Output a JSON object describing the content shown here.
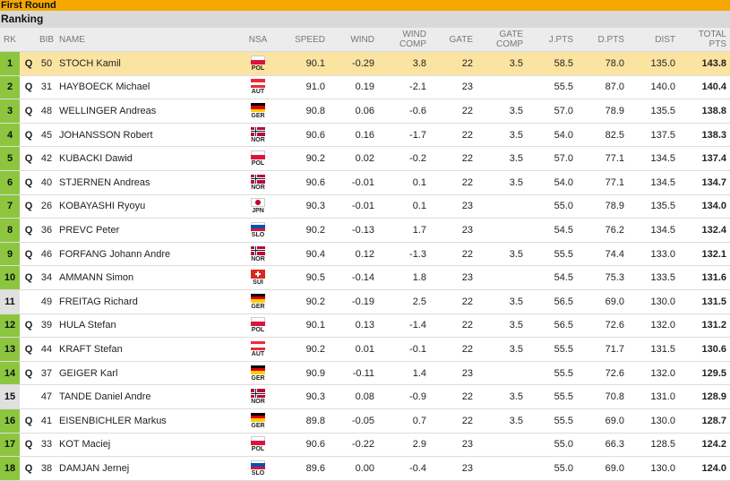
{
  "header": {
    "round_title": "First Round",
    "section_title": "Ranking"
  },
  "columns": {
    "rk": "RK",
    "bib": "BIB",
    "name": "NAME",
    "nsa": "NSA",
    "speed": "SPEED",
    "wind": "WIND",
    "wind_comp": [
      "WIND",
      "COMP"
    ],
    "gate": "GATE",
    "gate_comp": [
      "GATE",
      "COMP"
    ],
    "jpts": "J.PTS",
    "dpts": "D.PTS",
    "dist": "DIST",
    "total": [
      "TOTAL",
      "PTS"
    ]
  },
  "colors": {
    "round_bar": "#f5a800",
    "qualified_rank": "#8cc63f",
    "nonqualified_rank": "#e0e0e0",
    "highlight_row": "#fbe4a2"
  },
  "rows": [
    {
      "rk": "1",
      "q": "Q",
      "bib": "50",
      "name": "STOCH Kamil",
      "nsa": "POL",
      "speed": "90.1",
      "wind": "-0.29",
      "wind_comp": "3.8",
      "gate": "22",
      "gate_comp": "3.5",
      "jpts": "58.5",
      "dpts": "78.0",
      "dist": "135.0",
      "total": "143.8",
      "highlight": true
    },
    {
      "rk": "2",
      "q": "Q",
      "bib": "31",
      "name": "HAYBOECK Michael",
      "nsa": "AUT",
      "speed": "91.0",
      "wind": "0.19",
      "wind_comp": "-2.1",
      "gate": "23",
      "gate_comp": "",
      "jpts": "55.5",
      "dpts": "87.0",
      "dist": "140.0",
      "total": "140.4"
    },
    {
      "rk": "3",
      "q": "Q",
      "bib": "48",
      "name": "WELLINGER Andreas",
      "nsa": "GER",
      "speed": "90.8",
      "wind": "0.06",
      "wind_comp": "-0.6",
      "gate": "22",
      "gate_comp": "3.5",
      "jpts": "57.0",
      "dpts": "78.9",
      "dist": "135.5",
      "total": "138.8"
    },
    {
      "rk": "4",
      "q": "Q",
      "bib": "45",
      "name": "JOHANSSON Robert",
      "nsa": "NOR",
      "speed": "90.6",
      "wind": "0.16",
      "wind_comp": "-1.7",
      "gate": "22",
      "gate_comp": "3.5",
      "jpts": "54.0",
      "dpts": "82.5",
      "dist": "137.5",
      "total": "138.3"
    },
    {
      "rk": "5",
      "q": "Q",
      "bib": "42",
      "name": "KUBACKI Dawid",
      "nsa": "POL",
      "speed": "90.2",
      "wind": "0.02",
      "wind_comp": "-0.2",
      "gate": "22",
      "gate_comp": "3.5",
      "jpts": "57.0",
      "dpts": "77.1",
      "dist": "134.5",
      "total": "137.4"
    },
    {
      "rk": "6",
      "q": "Q",
      "bib": "40",
      "name": "STJERNEN Andreas",
      "nsa": "NOR",
      "speed": "90.6",
      "wind": "-0.01",
      "wind_comp": "0.1",
      "gate": "22",
      "gate_comp": "3.5",
      "jpts": "54.0",
      "dpts": "77.1",
      "dist": "134.5",
      "total": "134.7"
    },
    {
      "rk": "7",
      "q": "Q",
      "bib": "26",
      "name": "KOBAYASHI Ryoyu",
      "nsa": "JPN",
      "speed": "90.3",
      "wind": "-0.01",
      "wind_comp": "0.1",
      "gate": "23",
      "gate_comp": "",
      "jpts": "55.0",
      "dpts": "78.9",
      "dist": "135.5",
      "total": "134.0"
    },
    {
      "rk": "8",
      "q": "Q",
      "bib": "36",
      "name": "PREVC Peter",
      "nsa": "SLO",
      "speed": "90.2",
      "wind": "-0.13",
      "wind_comp": "1.7",
      "gate": "23",
      "gate_comp": "",
      "jpts": "54.5",
      "dpts": "76.2",
      "dist": "134.5",
      "total": "132.4"
    },
    {
      "rk": "9",
      "q": "Q",
      "bib": "46",
      "name": "FORFANG Johann Andre",
      "nsa": "NOR",
      "speed": "90.4",
      "wind": "0.12",
      "wind_comp": "-1.3",
      "gate": "22",
      "gate_comp": "3.5",
      "jpts": "55.5",
      "dpts": "74.4",
      "dist": "133.0",
      "total": "132.1"
    },
    {
      "rk": "10",
      "q": "Q",
      "bib": "34",
      "name": "AMMANN Simon",
      "nsa": "SUI",
      "speed": "90.5",
      "wind": "-0.14",
      "wind_comp": "1.8",
      "gate": "23",
      "gate_comp": "",
      "jpts": "54.5",
      "dpts": "75.3",
      "dist": "133.5",
      "total": "131.6"
    },
    {
      "rk": "11",
      "q": "",
      "bib": "49",
      "name": "FREITAG Richard",
      "nsa": "GER",
      "speed": "90.2",
      "wind": "-0.19",
      "wind_comp": "2.5",
      "gate": "22",
      "gate_comp": "3.5",
      "jpts": "56.5",
      "dpts": "69.0",
      "dist": "130.0",
      "total": "131.5"
    },
    {
      "rk": "12",
      "q": "Q",
      "bib": "39",
      "name": "HULA Stefan",
      "nsa": "POL",
      "speed": "90.1",
      "wind": "0.13",
      "wind_comp": "-1.4",
      "gate": "22",
      "gate_comp": "3.5",
      "jpts": "56.5",
      "dpts": "72.6",
      "dist": "132.0",
      "total": "131.2"
    },
    {
      "rk": "13",
      "q": "Q",
      "bib": "44",
      "name": "KRAFT Stefan",
      "nsa": "AUT",
      "speed": "90.2",
      "wind": "0.01",
      "wind_comp": "-0.1",
      "gate": "22",
      "gate_comp": "3.5",
      "jpts": "55.5",
      "dpts": "71.7",
      "dist": "131.5",
      "total": "130.6"
    },
    {
      "rk": "14",
      "q": "Q",
      "bib": "37",
      "name": "GEIGER Karl",
      "nsa": "GER",
      "speed": "90.9",
      "wind": "-0.11",
      "wind_comp": "1.4",
      "gate": "23",
      "gate_comp": "",
      "jpts": "55.5",
      "dpts": "72.6",
      "dist": "132.0",
      "total": "129.5"
    },
    {
      "rk": "15",
      "q": "",
      "bib": "47",
      "name": "TANDE Daniel Andre",
      "nsa": "NOR",
      "speed": "90.3",
      "wind": "0.08",
      "wind_comp": "-0.9",
      "gate": "22",
      "gate_comp": "3.5",
      "jpts": "55.5",
      "dpts": "70.8",
      "dist": "131.0",
      "total": "128.9"
    },
    {
      "rk": "16",
      "q": "Q",
      "bib": "41",
      "name": "EISENBICHLER Markus",
      "nsa": "GER",
      "speed": "89.8",
      "wind": "-0.05",
      "wind_comp": "0.7",
      "gate": "22",
      "gate_comp": "3.5",
      "jpts": "55.5",
      "dpts": "69.0",
      "dist": "130.0",
      "total": "128.7"
    },
    {
      "rk": "17",
      "q": "Q",
      "bib": "33",
      "name": "KOT Maciej",
      "nsa": "POL",
      "speed": "90.6",
      "wind": "-0.22",
      "wind_comp": "2.9",
      "gate": "23",
      "gate_comp": "",
      "jpts": "55.0",
      "dpts": "66.3",
      "dist": "128.5",
      "total": "124.2"
    },
    {
      "rk": "18",
      "q": "Q",
      "bib": "38",
      "name": "DAMJAN Jernej",
      "nsa": "SLO",
      "speed": "89.6",
      "wind": "0.00",
      "wind_comp": "-0.4",
      "gate": "23",
      "gate_comp": "",
      "jpts": "55.0",
      "dpts": "69.0",
      "dist": "130.0",
      "total": "124.0"
    }
  ]
}
